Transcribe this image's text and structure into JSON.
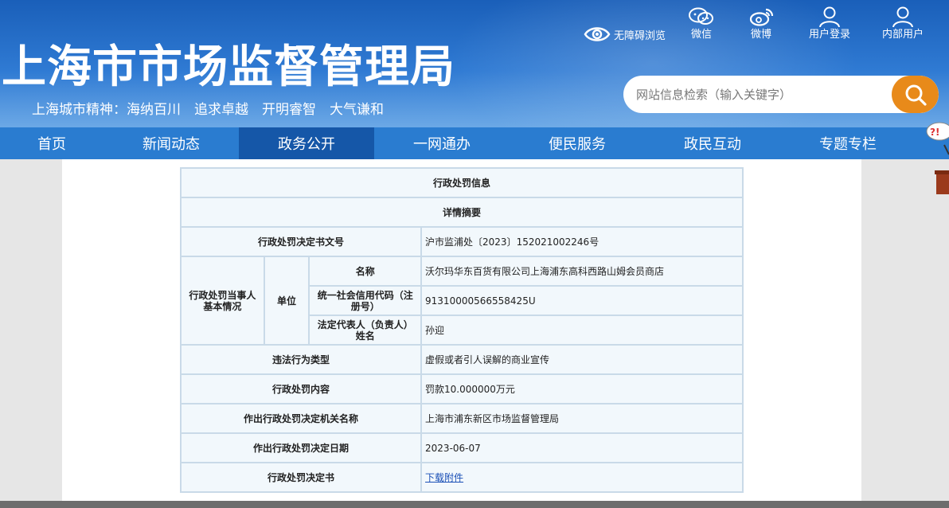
{
  "header": {
    "title": "上海市市场监督管理局",
    "slogan": "上海城市精神：海纳百川　追求卓越　开明睿智　大气谦和",
    "accessibility_label": "无障碍浏览",
    "links": [
      {
        "label": "微信",
        "icon": "wechat-icon"
      },
      {
        "label": "微博",
        "icon": "weibo-icon"
      },
      {
        "label": "用户登录",
        "icon": "user-icon"
      },
      {
        "label": "内部用户",
        "icon": "user-icon"
      }
    ]
  },
  "search": {
    "placeholder": "网站信息检索（输入关键字）",
    "icon": "search-icon",
    "button_color": "#e88a1a"
  },
  "nav": {
    "items": [
      {
        "label": "首页"
      },
      {
        "label": "新闻动态"
      },
      {
        "label": "政务公开"
      },
      {
        "label": "一网通办"
      },
      {
        "label": "便民服务"
      },
      {
        "label": "政民互动"
      },
      {
        "label": "专题专栏"
      }
    ],
    "active": "政务公开"
  },
  "table": {
    "title": "行政处罚信息",
    "subtitle": "详情摘要",
    "doc_no_label": "行政处罚决定书文号",
    "doc_no": "沪市监浦处〔2023〕152021002246号",
    "party_label": "行政处罚当事人基本情况",
    "unit_label": "单位",
    "name_label": "名称",
    "name": "沃尔玛华东百货有限公司上海浦东高科西路山姆会员商店",
    "credit_code_label": "统一社会信用代码（注册号）",
    "credit_code": "91310000566558425U",
    "legal_rep_label": "法定代表人（负责人）姓名",
    "legal_rep": "孙迎",
    "violation_type_label": "违法行为类型",
    "violation_type": "虚假或者引人误解的商业宣传",
    "penalty_content_label": "行政处罚内容",
    "penalty_content": "罚款10.000000万元",
    "authority_label": "作出行政处罚决定机关名称",
    "authority": "上海市浦东新区市场监督管理局",
    "date_label": "作出行政处罚决定日期",
    "date": "2023-06-07",
    "decision_doc_label": "行政处罚决定书",
    "download_label": "下载附件"
  }
}
